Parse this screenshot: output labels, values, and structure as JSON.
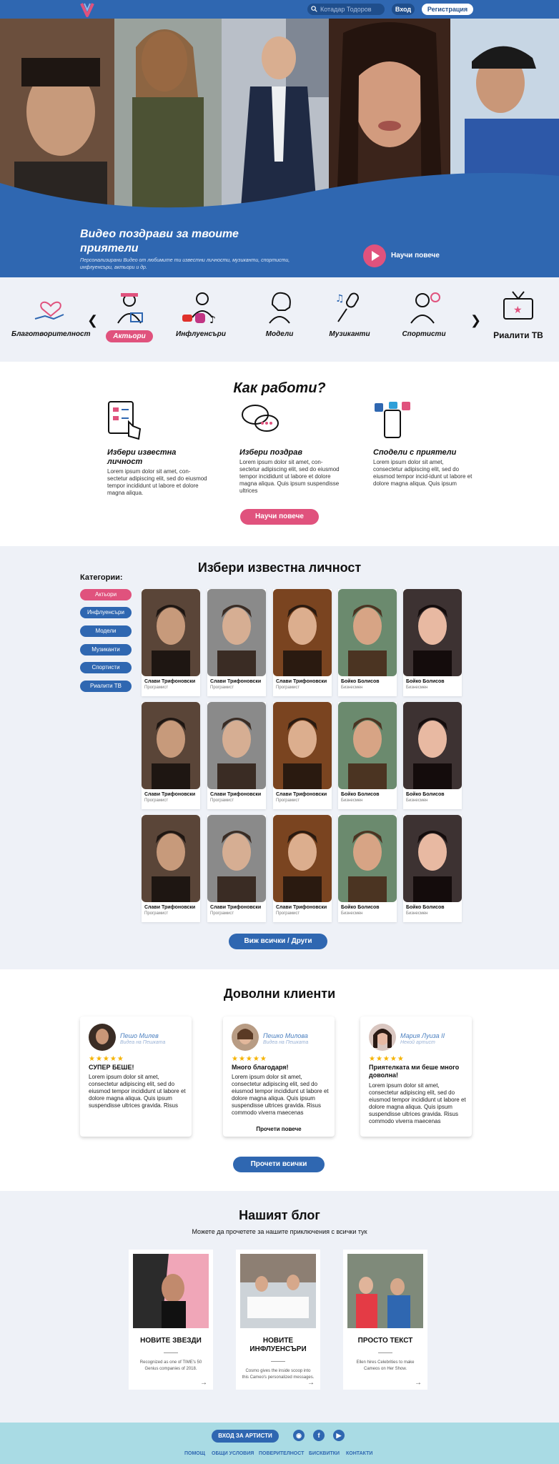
{
  "header": {
    "search_placeholder": "Котадар Тодоров",
    "login": "Вход",
    "register": "Регистрация"
  },
  "hero": {
    "title": "Видео поздрави за твоите приятели",
    "subtitle": "Персонализирани Видео от любимите ти известни личности, музиканти, спортисти, инфлуенсъри, актьори и др.",
    "cta": "Научи повече"
  },
  "categories": [
    {
      "label": "Благотворителност",
      "icon": "heart-hand-icon",
      "selected": false
    },
    {
      "label": "Актьори",
      "icon": "actor-icon",
      "selected": true
    },
    {
      "label": "Инфлуенсъри",
      "icon": "influencer-icon",
      "selected": false
    },
    {
      "label": "Модели",
      "icon": "model-icon",
      "selected": false
    },
    {
      "label": "Музиканти",
      "icon": "microphone-icon",
      "selected": false
    },
    {
      "label": "Спортисти",
      "icon": "athlete-icon",
      "selected": false
    },
    {
      "label": "Риалити ТВ",
      "icon": "tv-icon",
      "selected": false
    }
  ],
  "how": {
    "title": "Как работи?",
    "steps": [
      {
        "title": "Избери известна личност",
        "text": "Lorem ipsum dolor sit amet, con-sectetur adipiscing elit, sed do eiusmod tempor incididunt ut labore et dolore magna aliqua."
      },
      {
        "title": "Избери поздрав",
        "text": "Lorem ipsum dolor sit amet, con-sectetur adipiscing elit, sed do eiusmod tempor incididunt ut labore et dolore magna aliqua. Quis ipsum suspendisse ultrices"
      },
      {
        "title": "Сподели с приятели",
        "text": "Lorem ipsum dolor sit amet, consectetur adipiscing elit, sed do eiusmod tempor incid-idunt ut labore et dolore magna aliqua. Quis ipsum"
      }
    ],
    "cta": "Научи повече"
  },
  "celebs": {
    "title": "Избери известна личност",
    "side_title": "Категории:",
    "filters": [
      "Актьори",
      "Инфлуенсъри",
      "Модели",
      "Музиканти",
      "Спортисти",
      "Риалити ТВ"
    ],
    "rows": [
      [
        {
          "name": "Слави Трифоновски",
          "role": "Програмист"
        },
        {
          "name": "Слави Трифоновски",
          "role": "Програмист"
        },
        {
          "name": "Слави Трифоновски",
          "role": "Програмист"
        },
        {
          "name": "Бойко Болисов",
          "role": "Бизнесмен"
        },
        {
          "name": "Бойко Болисов",
          "role": "Бизнесмен"
        }
      ],
      [
        {
          "name": "Слави Трифоновски",
          "role": "Програмист"
        },
        {
          "name": "Слави Трифоновски",
          "role": "Програмист"
        },
        {
          "name": "Слави Трифоновски",
          "role": "Програмист"
        },
        {
          "name": "Бойко Болисов",
          "role": "Бизнесмен"
        },
        {
          "name": "Бойко Болисов",
          "role": "Бизнесмен"
        }
      ],
      [
        {
          "name": "Слави Трифоновски",
          "role": "Програмист"
        },
        {
          "name": "Слави Трифоновски",
          "role": "Програмист"
        },
        {
          "name": "Слави Трифоновски",
          "role": "Програмист"
        },
        {
          "name": "Бойко Болисов",
          "role": "Бизнесмен"
        },
        {
          "name": "Бойко Болисов",
          "role": "Бизнесмен"
        }
      ]
    ],
    "cta": "Виж всички / Други"
  },
  "testimonials": {
    "title": "Доволни клиенти",
    "items": [
      {
        "name": "Пешо Милев",
        "role": "Видеа на Пешката",
        "stars": "★★★★★",
        "heading": "СУПЕР БЕШЕ!",
        "text": "Lorem ipsum dolor sit amet, consectetur adipiscing elit, sed do eiusmod tempor incididunt ut labore et dolore magna aliqua. Quis ipsum suspendisse ultrices gravida. Risus",
        "more": ""
      },
      {
        "name": "Пешко Милова",
        "role": "Видеа на Пешката",
        "stars": "★★★★★",
        "heading": "Много благодаря!",
        "text": "Lorem ipsum dolor sit amet, consectetur adipiscing elit, sed do eiusmod tempor incididunt ut labore et dolore magna aliqua. Quis ipsum suspendisse ultrices gravida. Risus commodo viverra maecenas",
        "more": "Прочети повече"
      },
      {
        "name": "Мария Луиза II",
        "role": "Некой артист",
        "stars": "★★★★★",
        "heading": "Приятелката ми беше много доволна!",
        "text": "Lorem ipsum dolor sit amet, consectetur adipiscing elit, sed do eiusmod tempor incididunt ut labore et dolore magna aliqua. Quis ipsum suspendisse ultrices gravida. Risus commodo viverra maecenas",
        "more": ""
      }
    ],
    "cta": "Прочети всички"
  },
  "blog": {
    "title": "Нашият блог",
    "subtitle": "Можете да прочетете за нашите приключения с всички тук",
    "posts": [
      {
        "title": "НОВИТЕ ЗВЕЗДИ",
        "text": "Recognized as one of TIME's 50 Genius companies of 2018."
      },
      {
        "title": "НОВИТЕ ИНФЛУЕНСЪРИ",
        "text": "Cosmo gives the inside scoop into this Cameo's personalized messages."
      },
      {
        "title": "ПРОСТО ТЕКСТ",
        "text": "Ellen hires Celebrities to make Cameos on Her Show."
      }
    ]
  },
  "footer": {
    "artist_login": "ВХОД ЗА АРТИСТИ",
    "links": [
      "ПОМОЩ",
      "ОБЩИ УСЛОВИЯ",
      "ПОВЕРИТЕЛНОСТ",
      "БИСКВИТКИ",
      "КОНТАКТИ"
    ],
    "social": [
      "instagram-icon",
      "facebook-icon",
      "youtube-icon"
    ]
  },
  "colors": {
    "brand_blue": "#2f67b1",
    "accent_pink": "#e0527d",
    "light_bg": "#eef1f7",
    "footer_bg": "#a9dbe4"
  }
}
